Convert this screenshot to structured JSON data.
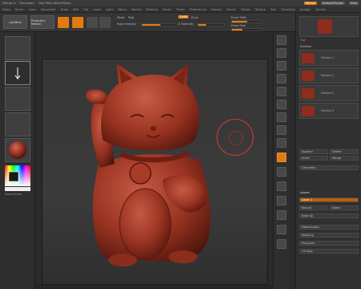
{
  "titlebar": {
    "app": "ZBrush 4",
    "document": "Document",
    "stats": "Free Mem ActivePoints",
    "menus_btn": "Menus",
    "script_btn": "DefaultZScript",
    "help_btn": "Help"
  },
  "menubar": {
    "items": [
      "Alpha",
      "Brush",
      "Color",
      "Document",
      "Draw",
      "Edit",
      "File",
      "Layer",
      "Light",
      "Macro",
      "Marker",
      "Material",
      "Movie",
      "Picker",
      "Preferences",
      "Render",
      "Stencil",
      "Stroke",
      "Texture",
      "Tool",
      "Transform",
      "Zplugin",
      "Zscript"
    ]
  },
  "toolbar": {
    "lightbox_label": "LightBox",
    "projection_label": "Projection Master",
    "edit_label": "Edit",
    "draw_label": "Draw",
    "mrgb_label": "Mrgb",
    "rgb_label": "Rgb",
    "m_label": "M",
    "zadd_label": "Zadd",
    "zsub_label": "Zsub",
    "focal_label": "Focal Shift",
    "draw_size_label": "Draw Size",
    "rgb_intensity_label": "Rgb Intensity",
    "z_intensity_label": "Z Intensity",
    "rgb_intensity": 0.55,
    "z_intensity": 0.3,
    "focal_shift": 0.5,
    "draw_size": 0.35
  },
  "left_tray": {
    "swatch_label": "SwitchColor"
  },
  "right_panel": {
    "header": "Tool",
    "subtool_title": "SubTool",
    "subtools": [
      {
        "label": "Subtool 1"
      },
      {
        "label": "Subtool 2"
      },
      {
        "label": "Subtool 3"
      },
      {
        "label": "Subtool 4"
      }
    ],
    "append_label": "Append",
    "delete_label": "Delete",
    "insert_label": "Insert",
    "merge_label": "Merge",
    "geometry_label": "Geometry",
    "layers_label": "Layers",
    "layer_name": "Layer 1",
    "record_label": "Record",
    "name_label": "Name",
    "bake_label": "Bake All",
    "deformation_label": "Deformation",
    "masking_label": "Masking",
    "polypaint_label": "Polypaint",
    "uvmap_label": "UV Map"
  },
  "colors": {
    "accent": "#e07b10",
    "model": "#9a3422",
    "cursor": "#d43a2f"
  },
  "icons": [
    "lightbox-icon",
    "move-icon",
    "scale-icon",
    "rotate-icon",
    "frame-icon",
    "persp-icon",
    "floor-icon",
    "local-icon",
    "xpose-icon",
    "transp-icon",
    "polyf-icon",
    "zoom-icon",
    "actual-icon"
  ]
}
